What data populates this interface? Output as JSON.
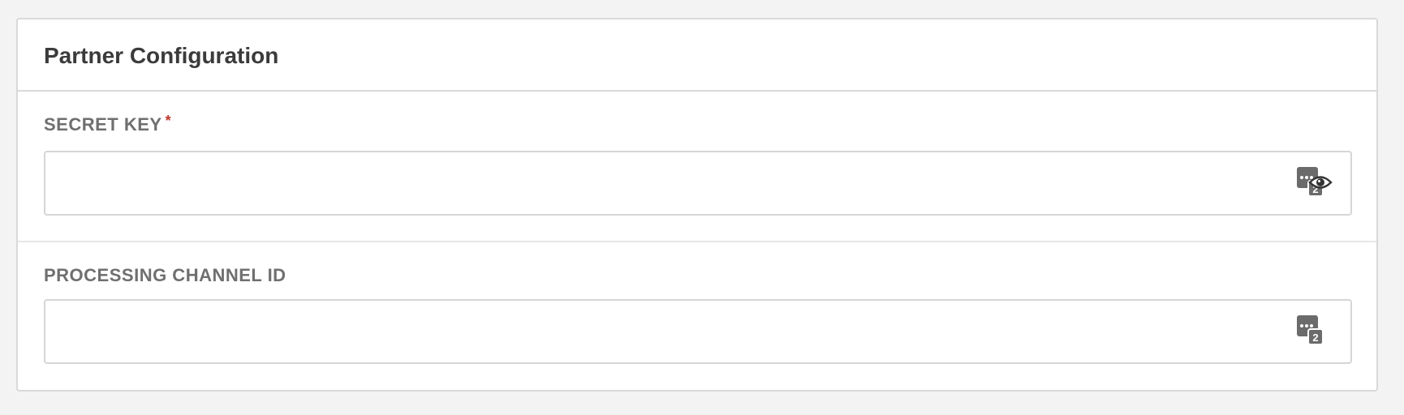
{
  "panel": {
    "title": "Partner Configuration"
  },
  "fields": [
    {
      "label": "SECRET KEY",
      "required": "*",
      "value": ""
    },
    {
      "label": "PROCESSING CHANNEL ID",
      "value": ""
    }
  ],
  "icons": {
    "password_manager": "password-manager-icon",
    "reveal": "eye-icon",
    "password_manager_badge": "2"
  },
  "colors": {
    "background": "#f3f3f3",
    "card": "#ffffff",
    "label": "#6f6f6f",
    "title": "#3b3b3b",
    "required": "#c0392b",
    "icon": "#6b6b6b"
  }
}
